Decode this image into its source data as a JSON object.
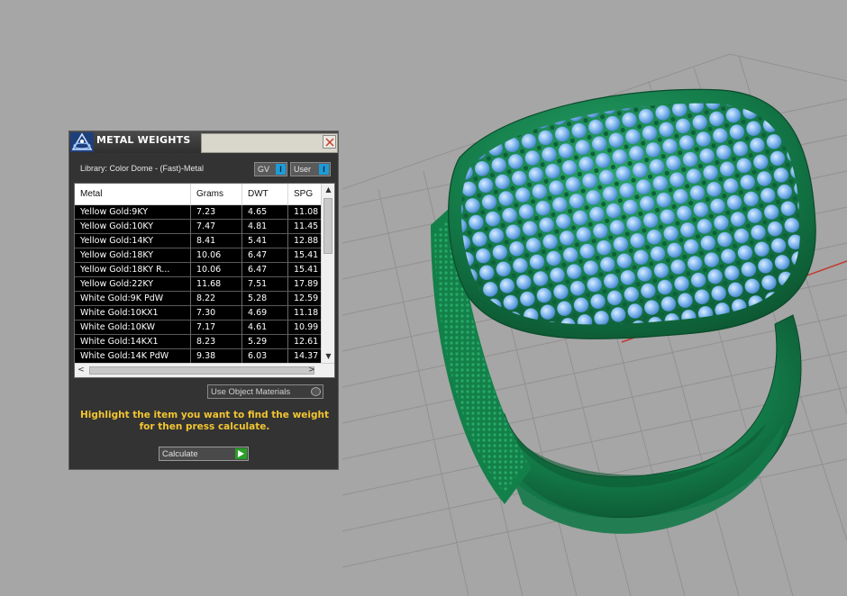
{
  "dialog": {
    "title": "METAL WEIGHTS",
    "library_label": "Library: Color Dome - (Fast)-Metal",
    "toggles": [
      {
        "label": "GV",
        "state": "on"
      },
      {
        "label": "User",
        "state": "on"
      }
    ],
    "table": {
      "columns": [
        "Metal",
        "Grams",
        "DWT",
        "SPG"
      ],
      "rows": [
        {
          "metal": "Yellow Gold:9KY",
          "grams": "7.23",
          "dwt": "4.65",
          "spg": "11.08"
        },
        {
          "metal": "Yellow Gold:10KY",
          "grams": "7.47",
          "dwt": "4.81",
          "spg": "11.45"
        },
        {
          "metal": "Yellow Gold:14KY",
          "grams": "8.41",
          "dwt": "5.41",
          "spg": "12.88"
        },
        {
          "metal": "Yellow Gold:18KY",
          "grams": "10.06",
          "dwt": "6.47",
          "spg": "15.41"
        },
        {
          "metal": "Yellow Gold:18KY R...",
          "grams": "10.06",
          "dwt": "6.47",
          "spg": "15.41"
        },
        {
          "metal": "Yellow Gold:22KY",
          "grams": "11.68",
          "dwt": "7.51",
          "spg": "17.89"
        },
        {
          "metal": "White Gold:9K PdW",
          "grams": "8.22",
          "dwt": "5.28",
          "spg": "12.59"
        },
        {
          "metal": "White Gold:10KX1",
          "grams": "7.30",
          "dwt": "4.69",
          "spg": "11.18"
        },
        {
          "metal": "White Gold:10KW",
          "grams": "7.17",
          "dwt": "4.61",
          "spg": "10.99"
        },
        {
          "metal": "White Gold:14KX1",
          "grams": "8.23",
          "dwt": "5.29",
          "spg": "12.61"
        },
        {
          "metal": "White Gold:14K PdW",
          "grams": "9.38",
          "dwt": "6.03",
          "spg": "14.37"
        }
      ]
    },
    "use_object_materials_label": "Use Object Materials",
    "instructions": "Highlight the item you want to find the weight for then press calculate.",
    "calculate_label": "Calculate"
  },
  "colors": {
    "viewport_bg": "#a6a6a6",
    "ring_green": "#1a8a55",
    "gem_blue": "#7db7f2",
    "instruction_yellow": "#f2c531"
  },
  "icons": [
    "app-logo-icon",
    "close-icon",
    "scroll-up-icon",
    "scroll-down-icon",
    "scroll-left-icon",
    "scroll-right-icon",
    "play-arrow-icon"
  ]
}
